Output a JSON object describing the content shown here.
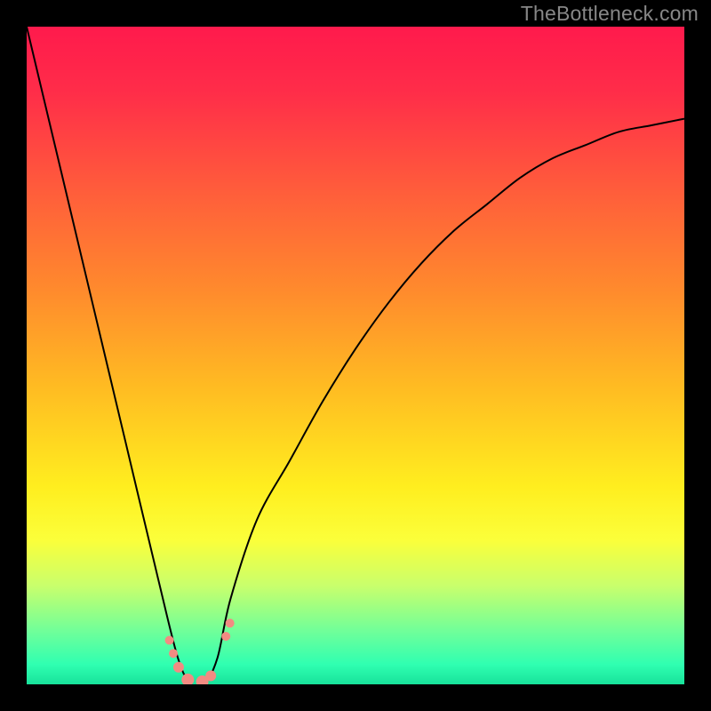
{
  "watermark": "TheBottleneck.com",
  "chart_data": {
    "type": "line",
    "title": "",
    "xlabel": "",
    "ylabel": "",
    "x": [
      0,
      5,
      10,
      15,
      20,
      23,
      25,
      27,
      29,
      31,
      35,
      40,
      45,
      50,
      55,
      60,
      65,
      70,
      75,
      80,
      85,
      90,
      95,
      100
    ],
    "y": [
      100,
      79,
      58,
      37,
      16,
      4,
      0,
      0,
      4,
      13,
      25,
      34,
      43,
      51,
      58,
      64,
      69,
      73,
      77,
      80,
      82,
      84,
      85,
      86
    ],
    "xlim": [
      0,
      100
    ],
    "ylim": [
      0,
      100
    ],
    "gradient_stops": [
      {
        "offset": 0.0,
        "color": "#ff1a4c"
      },
      {
        "offset": 0.1,
        "color": "#ff2d49"
      },
      {
        "offset": 0.25,
        "color": "#ff5d3b"
      },
      {
        "offset": 0.4,
        "color": "#ff8a2d"
      },
      {
        "offset": 0.55,
        "color": "#ffbc22"
      },
      {
        "offset": 0.7,
        "color": "#ffee1f"
      },
      {
        "offset": 0.78,
        "color": "#fbff3a"
      },
      {
        "offset": 0.85,
        "color": "#c9ff6c"
      },
      {
        "offset": 0.92,
        "color": "#6fff9a"
      },
      {
        "offset": 0.97,
        "color": "#2fffb1"
      },
      {
        "offset": 1.0,
        "color": "#18e29b"
      }
    ],
    "markers": [
      {
        "x": 21.7,
        "y": 6.7,
        "r": 5
      },
      {
        "x": 22.3,
        "y": 4.7,
        "r": 5
      },
      {
        "x": 23.1,
        "y": 2.6,
        "r": 6
      },
      {
        "x": 24.5,
        "y": 0.7,
        "r": 7
      },
      {
        "x": 26.7,
        "y": 0.4,
        "r": 7
      },
      {
        "x": 28.0,
        "y": 1.3,
        "r": 6
      },
      {
        "x": 30.3,
        "y": 7.3,
        "r": 5
      },
      {
        "x": 30.9,
        "y": 9.3,
        "r": 5
      }
    ],
    "marker_color": "#f28b82",
    "curve_color": "#000000"
  }
}
